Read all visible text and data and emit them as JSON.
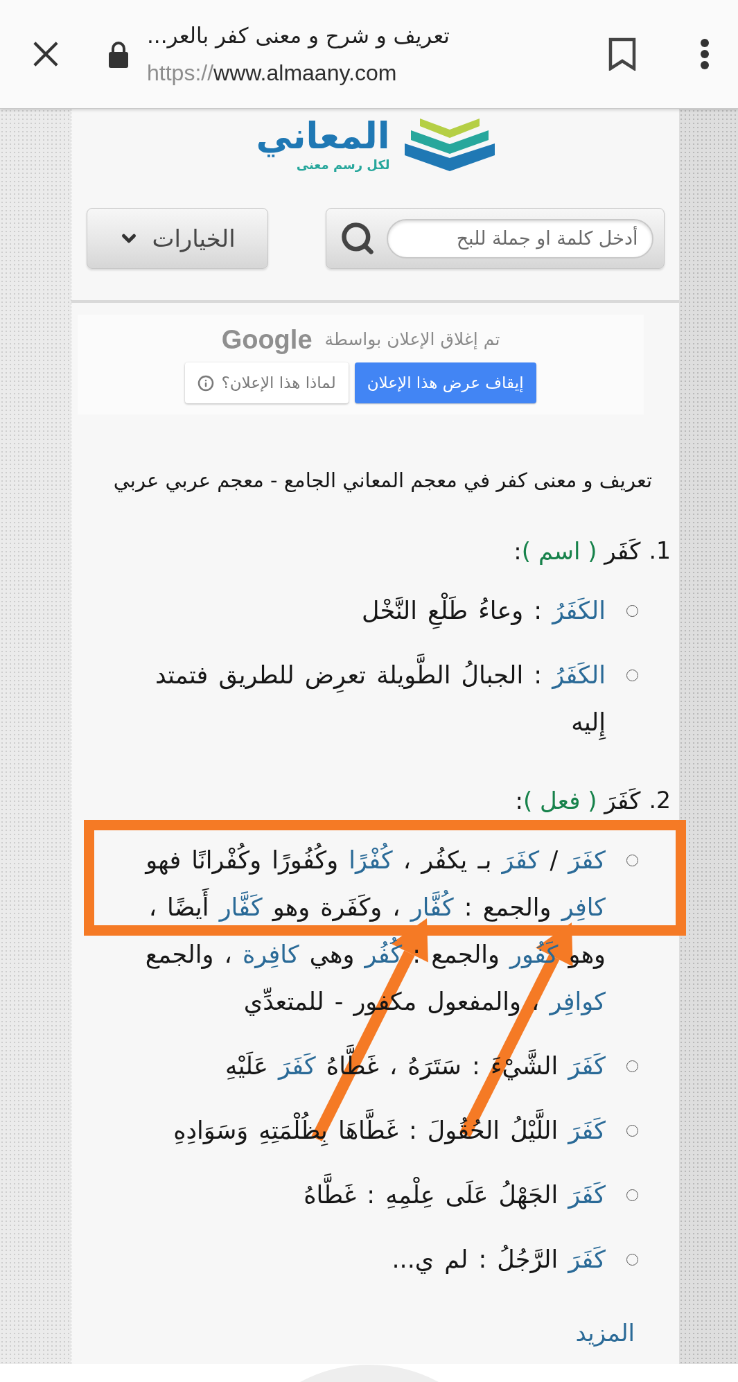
{
  "browser_bar": {
    "title": "تعريف و شرح و معنى كفر بالعر...",
    "url_scheme": "https://",
    "url_host": "www.almaany.com"
  },
  "logo": {
    "name": "المعاني",
    "tagline": "لكل رسم معنى"
  },
  "search": {
    "placeholder": "أدخل كلمة او جملة للبح"
  },
  "options_button": {
    "label": "الخيارات"
  },
  "ad_notice": {
    "message": "تم إغلاق الإعلان بواسطة",
    "brand": "Google",
    "buttons": [
      {
        "label": "إيقاف عرض هذا الإعلان",
        "kind": "primary"
      },
      {
        "label": "لماذا هذا الإعلان؟",
        "kind": "info"
      }
    ]
  },
  "heading": "تعريف و معنى كفر في معجم المعاني الجامع - معجم عربي عربي",
  "entries": [
    {
      "number": "1.",
      "heading": [
        {
          "kind": "word",
          "text": "كَفَر"
        },
        {
          "kind": "pos",
          "text": " ( اسم )"
        },
        {
          "kind": "text",
          "text": ":"
        }
      ],
      "definitions": [
        {
          "annotated": false,
          "segments": [
            {
              "kind": "term",
              "text": "الكَفَرُ"
            },
            {
              "kind": "text",
              "text": " : وعاءُ طَلْعِ النَّخْل"
            }
          ]
        },
        {
          "annotated": false,
          "segments": [
            {
              "kind": "term",
              "text": "الكَفَرُ"
            },
            {
              "kind": "text",
              "text": " : الجبالُ الطَّويلة تعرِض للطريق فتمتد إِليه"
            }
          ]
        }
      ]
    },
    {
      "number": "2.",
      "heading": [
        {
          "kind": "word",
          "text": "كَفَرَ"
        },
        {
          "kind": "pos",
          "text": " ( فعل )"
        },
        {
          "kind": "text",
          "text": ":"
        }
      ],
      "definitions": [
        {
          "annotated": true,
          "segments": [
            {
              "kind": "term",
              "text": "كفَرَ"
            },
            {
              "kind": "text",
              "text": " / "
            },
            {
              "kind": "term",
              "text": "كفَرَ"
            },
            {
              "kind": "text",
              "text": " بـ يكفُر ، "
            },
            {
              "kind": "term",
              "text": "كُفْرًا"
            },
            {
              "kind": "text",
              "text": " وكُفُورًا وكُفْرانًا فهو "
            },
            {
              "kind": "term",
              "text": "كافِر"
            },
            {
              "kind": "text",
              "text": " والجمع : "
            },
            {
              "kind": "term",
              "text": "كُفَّار"
            },
            {
              "kind": "text",
              "text": " ، وكَفَرة وهو "
            },
            {
              "kind": "term",
              "text": "كَفَّار"
            },
            {
              "kind": "text",
              "text": " أَيضًا ، وهو "
            },
            {
              "kind": "term",
              "text": "كَفُور"
            },
            {
              "kind": "text",
              "text": " والجمع : "
            },
            {
              "kind": "term",
              "text": "كُفُر"
            },
            {
              "kind": "text",
              "text": " وهي "
            },
            {
              "kind": "term",
              "text": "كافِرة"
            },
            {
              "kind": "text",
              "text": " ، والجمع "
            },
            {
              "kind": "term",
              "text": "كوافِر"
            },
            {
              "kind": "text",
              "text": " ، والمفعول مكفور - للمتعدِّي"
            }
          ]
        },
        {
          "annotated": false,
          "segments": [
            {
              "kind": "term",
              "text": "كَفَرَ"
            },
            {
              "kind": "text",
              "text": " الشَّيْءَ : سَتَرَهُ ، غَطَّاهُ "
            },
            {
              "kind": "term",
              "text": "كَفَرَ"
            },
            {
              "kind": "text",
              "text": " عَلَيْهِ"
            }
          ]
        },
        {
          "annotated": false,
          "segments": [
            {
              "kind": "term",
              "text": "كَفَرَ"
            },
            {
              "kind": "text",
              "text": " اللَّيْلُ الحُقُولَ : غَطَّاهَا بِظُلْمَتِهِ وَسَوَادِهِ"
            }
          ]
        },
        {
          "annotated": false,
          "segments": [
            {
              "kind": "term",
              "text": "كَفَرَ"
            },
            {
              "kind": "text",
              "text": " الجَهْلُ عَلَى عِلْمِهِ : غَطَّاهُ"
            }
          ]
        },
        {
          "annotated": false,
          "segments": [
            {
              "kind": "term",
              "text": "كَفَرَ"
            },
            {
              "kind": "text",
              "text": " الرَّجُلُ : لم ي..."
            }
          ]
        }
      ]
    }
  ],
  "more_link": "المزيد"
}
